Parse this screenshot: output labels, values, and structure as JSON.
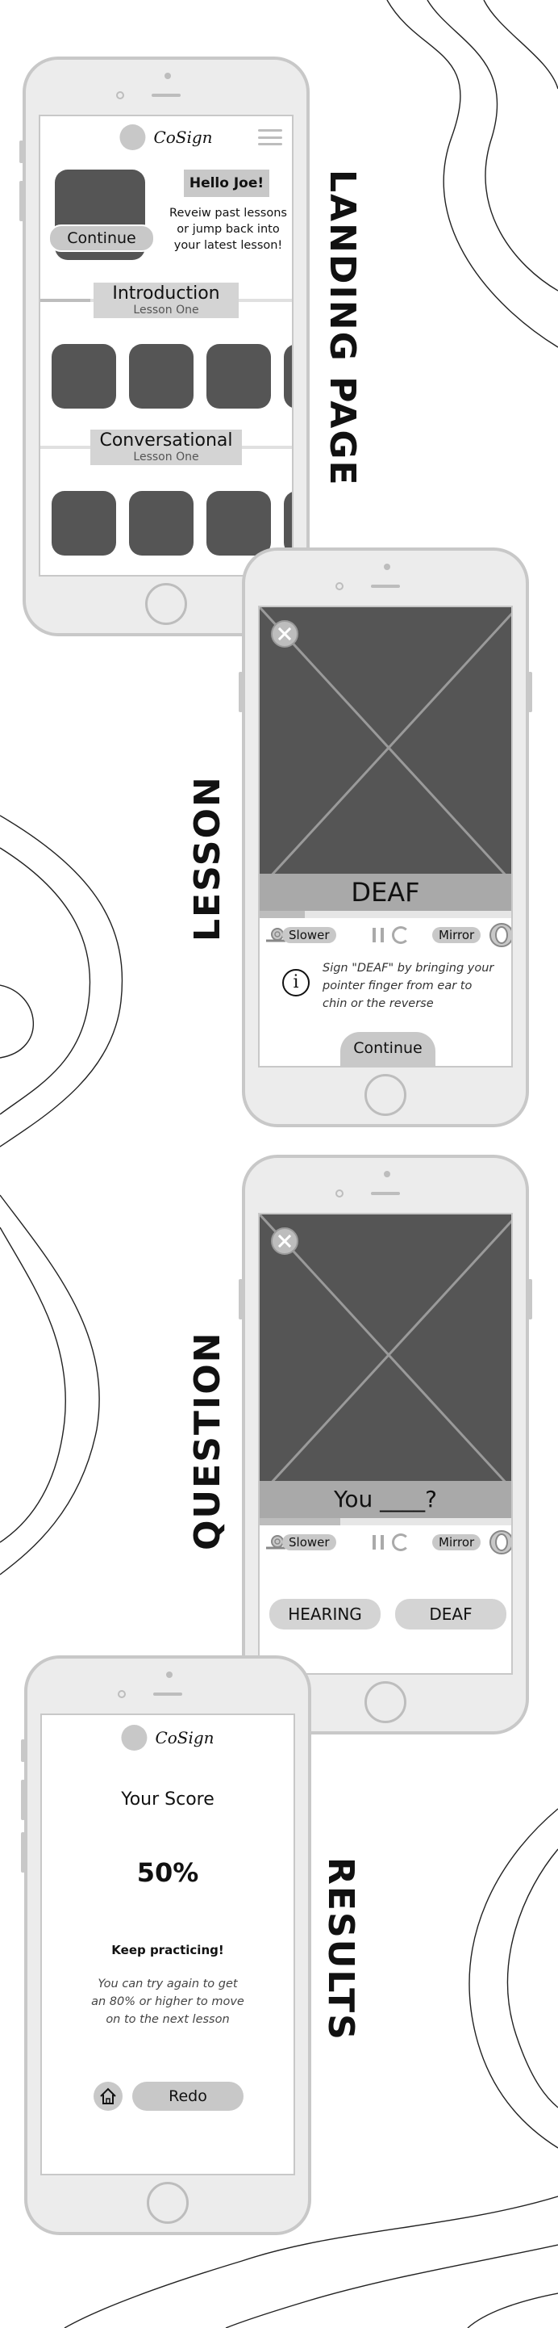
{
  "sections": {
    "landing": "LANDING PAGE",
    "lesson": "LESSON",
    "question": "QUESTION",
    "results": "RESULTS"
  },
  "landing": {
    "brand": "CoSign",
    "greeting": "Hello Joe!",
    "message": [
      "Reveiw past lessons",
      "or jump back into",
      "your latest lesson!"
    ],
    "continue": "Continue",
    "groups": [
      {
        "title": "Introduction",
        "subtitle": "Lesson One",
        "progress": 0.2
      },
      {
        "title": "Conversational",
        "subtitle": "Lesson One",
        "progress": 0.0
      }
    ]
  },
  "lesson": {
    "caption": "DEAF",
    "progress": 0.18,
    "slower": "Slower",
    "mirror": "Mirror",
    "instruction": [
      "Sign \"DEAF\" by bringing your",
      "pointer finger from ear to",
      "chin or the reverse"
    ],
    "continue": "Continue"
  },
  "question": {
    "caption": "You ____?",
    "progress": 0.32,
    "slower": "Slower",
    "mirror": "Mirror",
    "answers": [
      "HEARING",
      "DEAF"
    ]
  },
  "results": {
    "brand": "CoSign",
    "heading": "Your Score",
    "score": "50%",
    "feedback": "Keep practicing!",
    "detail": [
      "You can try again to get",
      "an 80% or higher to move",
      "on to the next lesson"
    ],
    "redo": "Redo"
  },
  "colors": {
    "tile": "#555555",
    "pill": "#c8c8c8",
    "frame": "#ececec"
  }
}
